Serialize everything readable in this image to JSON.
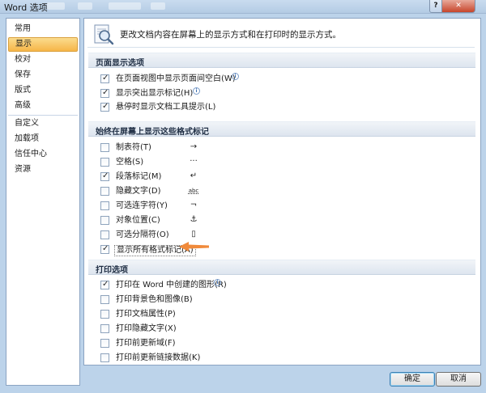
{
  "window": {
    "title": "Word 选项",
    "help_glyph": "?",
    "close_glyph": "✕"
  },
  "sidebar": {
    "items": [
      {
        "label": "常用",
        "selected": false
      },
      {
        "label": "显示",
        "selected": true
      },
      {
        "label": "校对",
        "selected": false
      },
      {
        "label": "保存",
        "selected": false
      },
      {
        "label": "版式",
        "selected": false
      },
      {
        "label": "高级",
        "selected": false
      },
      {
        "label": "自定义",
        "selected": false
      },
      {
        "label": "加载项",
        "selected": false
      },
      {
        "label": "信任中心",
        "selected": false
      },
      {
        "label": "资源",
        "selected": false
      }
    ]
  },
  "header": {
    "description": "更改文档内容在屏幕上的显示方式和在打印时的显示方式。"
  },
  "page_display": {
    "title": "页面显示选项",
    "options": [
      {
        "label": "在页面视图中显示页面间空白(W)",
        "checked": true
      },
      {
        "label": "显示突出显示标记(H)",
        "checked": true
      },
      {
        "label": "悬停时显示文档工具提示(L)",
        "checked": true
      }
    ]
  },
  "formatting_marks": {
    "title": "始终在屏幕上显示这些格式标记",
    "options": [
      {
        "label": "制表符(T)",
        "checked": false,
        "symbol": "→"
      },
      {
        "label": "空格(S)",
        "checked": false,
        "symbol": "···"
      },
      {
        "label": "段落标记(M)",
        "checked": true,
        "symbol": "↵"
      },
      {
        "label": "隐藏文字(D)",
        "checked": false,
        "symbol": "abc"
      },
      {
        "label": "可选连字符(Y)",
        "checked": false,
        "symbol": "¬"
      },
      {
        "label": "对象位置(C)",
        "checked": false,
        "symbol": "⚓"
      },
      {
        "label": "可选分隔符(O)",
        "checked": false,
        "symbol": "▯"
      },
      {
        "label": "显示所有格式标记(A)",
        "checked": true,
        "symbol": ""
      }
    ]
  },
  "print_options": {
    "title": "打印选项",
    "options": [
      {
        "label": "打印在 Word 中创建的图形(R)",
        "checked": true
      },
      {
        "label": "打印背景色和图像(B)",
        "checked": false
      },
      {
        "label": "打印文档属性(P)",
        "checked": false
      },
      {
        "label": "打印隐藏文字(X)",
        "checked": false
      },
      {
        "label": "打印前更新域(F)",
        "checked": false
      },
      {
        "label": "打印前更新链接数据(K)",
        "checked": false
      }
    ]
  },
  "buttons": {
    "ok": "确定",
    "cancel": "取消"
  },
  "colors": {
    "selection": "#f6b548",
    "accent_arrow": "#f08a3b",
    "frame": "#bcd3ea"
  }
}
